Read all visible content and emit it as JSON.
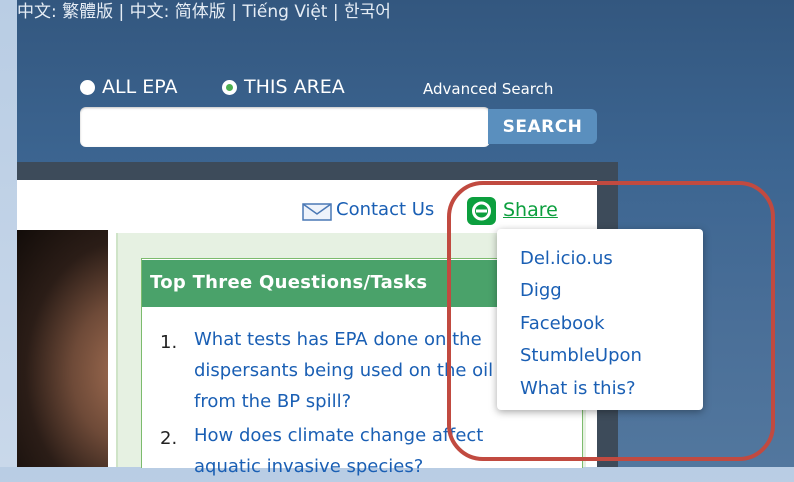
{
  "header": {
    "languages": "中文: 繁體版  |  中文: 简体版  |  Tiếng Việt  |  한국어",
    "radio_all": "ALL EPA",
    "radio_area": "THIS AREA",
    "advanced_search": "Advanced Search",
    "search_value": "",
    "search_button": "SEARCH"
  },
  "toolbar": {
    "contact_us": "Contact Us",
    "share": "Share"
  },
  "top_three": {
    "title": "Top Three Questions/Tasks",
    "items": [
      {
        "num": "1.",
        "text": "What tests has EPA done on the dispersants being used on the oil from the BP spill?"
      },
      {
        "num": "2.",
        "text": "How does climate change affect aquatic invasive species?"
      }
    ]
  },
  "share_menu": {
    "items": [
      "Del.icio.us",
      "Digg",
      "Facebook",
      "StumbleUpon",
      "What is this?"
    ]
  },
  "colors": {
    "header_blue": "#3c6591",
    "share_green": "#0c9f3e",
    "link_blue": "#1a5fb4",
    "annotation_red": "#c14a40"
  },
  "icons": {
    "mail": "envelope-icon",
    "share": "share-icon"
  }
}
